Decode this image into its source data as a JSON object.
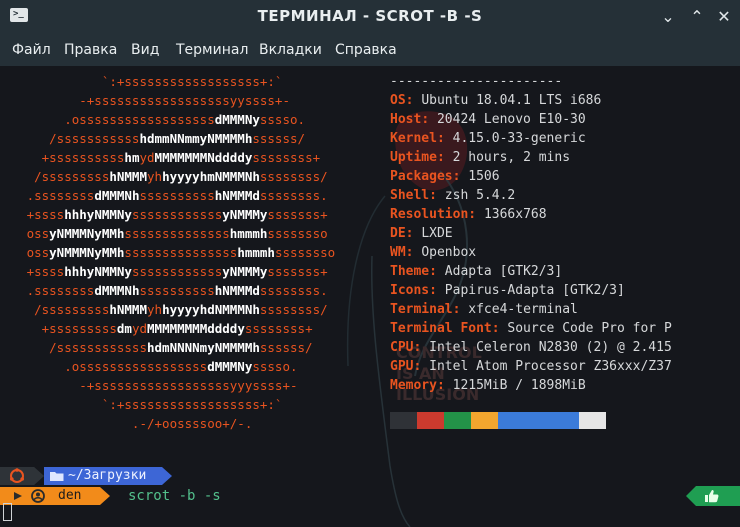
{
  "window": {
    "title": "ТЕРМИНАЛ - SCROT -B -S",
    "app_icon_glyph": ">_",
    "minimize_glyph": "⌄",
    "maximize_glyph": "⌃",
    "close_glyph": "✕"
  },
  "menu": [
    "Файл",
    "Правка",
    "Вид",
    "Терминал",
    "Вкладки",
    "Справка"
  ],
  "neofetch": {
    "separator": "----------------------",
    "info": [
      {
        "key": "OS",
        "value": "Ubuntu 18.04.1 LTS i686"
      },
      {
        "key": "Host",
        "value": "20424 Lenovo E10-30"
      },
      {
        "key": "Kernel",
        "value": "4.15.0-33-generic"
      },
      {
        "key": "Uptime",
        "value": "2 hours, 2 mins"
      },
      {
        "key": "Packages",
        "value": "1506"
      },
      {
        "key": "Shell",
        "value": "zsh 5.4.2"
      },
      {
        "key": "Resolution",
        "value": "1366x768"
      },
      {
        "key": "DE",
        "value": "LXDE"
      },
      {
        "key": "WM",
        "value": "Openbox"
      },
      {
        "key": "Theme",
        "value": "Adapta [GTK2/3]"
      },
      {
        "key": "Icons",
        "value": "Papirus-Adapta [GTK2/3]"
      },
      {
        "key": "Terminal",
        "value": "xfce4-terminal"
      },
      {
        "key": "Terminal Font",
        "value": "Source Code Pro for P"
      },
      {
        "key": "CPU",
        "value": "Intel Celeron N2830 (2) @ 2.415"
      },
      {
        "key": "GPU",
        "value": "Intel Atom Processor Z36xxx/Z37"
      },
      {
        "key": "Memory",
        "value": "1215MiB / 1898MiB"
      }
    ],
    "palette": [
      "#2f3237",
      "#cc3a2e",
      "#239248",
      "#f2a62e",
      "#3b7bd9",
      "#3b7bd9",
      "#3b7bd9",
      "#3b7bd9",
      "#e6e6e6"
    ]
  },
  "background_text": [
    "CONTROL",
    "IS AN",
    "ILLUSION"
  ],
  "prompt": {
    "os_icon_color": "#e95420",
    "path_icon": "folder-icon",
    "path": "~/Загрузки",
    "user_icon": "user-icon",
    "user": "den",
    "command": "scrot -b -s",
    "status_icon": "thumbs-up-icon"
  },
  "colors": {
    "accent": "#e95420",
    "prompt_path_bg": "#3d66d6",
    "prompt_user_bg": "#f28b1a",
    "prompt_ok_bg": "#1f9e52"
  }
}
